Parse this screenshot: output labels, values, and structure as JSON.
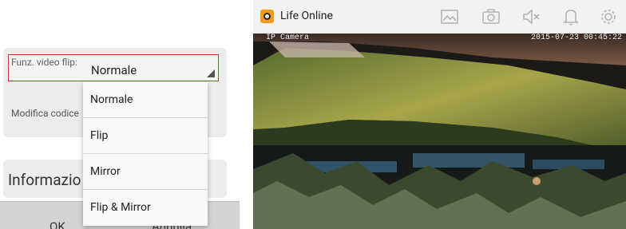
{
  "settings": {
    "flip_label": "Funz. video flip:",
    "flip_value": "Normale",
    "modifica_label": "Modifica codice",
    "info_title": "Informazio",
    "ok_label": "OK",
    "annulla_label": "Annulla"
  },
  "dropdown": {
    "options": [
      "Normale",
      "Flip",
      "Mirror",
      "Flip & Mirror"
    ]
  },
  "app": {
    "title": "Life Online",
    "icons": [
      "image-icon",
      "camera-icon",
      "speaker-muted-icon",
      "bell-icon",
      "gear-icon"
    ]
  },
  "camera": {
    "label": "IP Camera",
    "timestamp": "2015-07-23 00:45:22"
  },
  "colors": {
    "highlight_border": "#d8362f",
    "app_icon": "#f29a1c"
  }
}
